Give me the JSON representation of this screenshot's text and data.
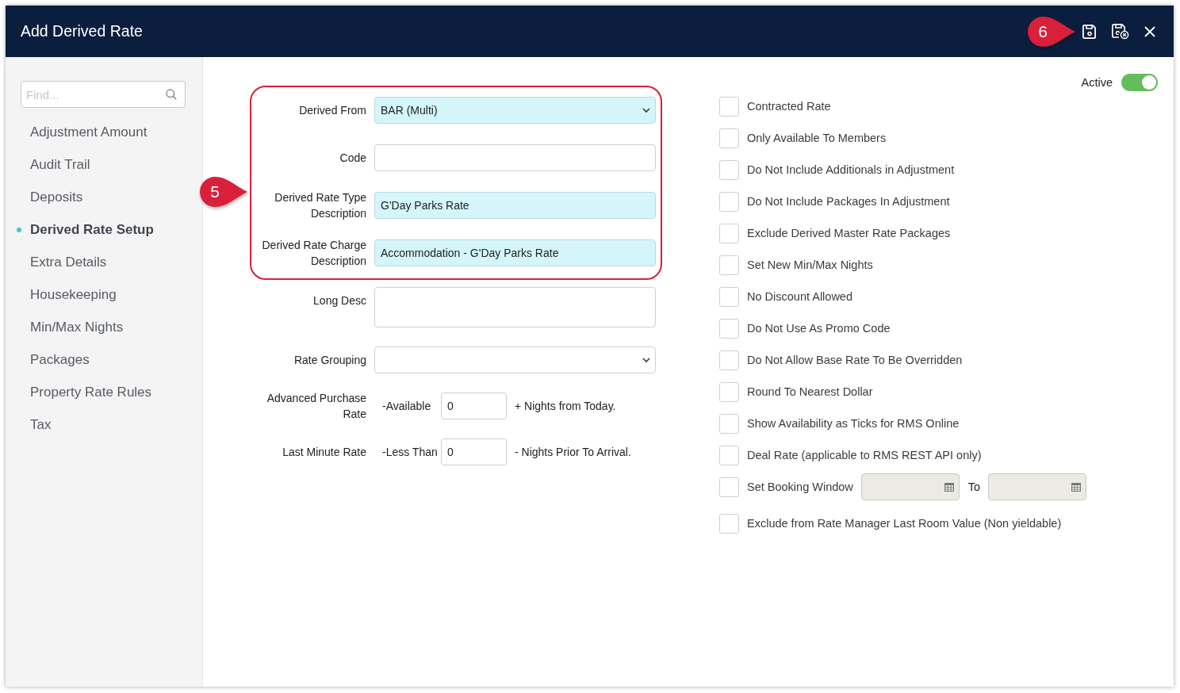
{
  "window": {
    "title": "Add Derived Rate"
  },
  "header_callout": {
    "label": "6"
  },
  "sidebar": {
    "search": {
      "placeholder": "Find..."
    },
    "items": [
      {
        "label": "Adjustment Amount",
        "selected": false
      },
      {
        "label": "Audit Trail",
        "selected": false
      },
      {
        "label": "Deposits",
        "selected": false
      },
      {
        "label": "Derived Rate Setup",
        "selected": true
      },
      {
        "label": "Extra Details",
        "selected": false
      },
      {
        "label": "Housekeeping",
        "selected": false
      },
      {
        "label": "Min/Max Nights",
        "selected": false
      },
      {
        "label": "Packages",
        "selected": false
      },
      {
        "label": "Property Rate Rules",
        "selected": false
      },
      {
        "label": "Tax",
        "selected": false
      }
    ]
  },
  "form": {
    "callout": {
      "label": "5"
    },
    "boxed_fields": [
      {
        "kind": "select",
        "label": "Derived From",
        "value": "BAR (Multi)",
        "highlighted": true
      },
      {
        "kind": "text",
        "label": "Code",
        "highlighted": false
      },
      {
        "kind": "text",
        "label": "Derived Rate Type Description",
        "value": "G'Day Parks Rate",
        "highlighted": true
      },
      {
        "kind": "text",
        "label": "Derived Rate Charge Description",
        "value": "Accommodation - G'Day Parks Rate",
        "highlighted": true
      }
    ],
    "fields": [
      {
        "kind": "textarea",
        "label": "Long Desc",
        "highlighted": false
      },
      {
        "kind": "select",
        "label": "Rate Grouping",
        "highlighted": false
      },
      {
        "kind": "nights",
        "label": "Advanced Purchase Rate",
        "prefix": "-Available",
        "value": "0",
        "suffix": "+ Nights from Today."
      },
      {
        "kind": "nights",
        "label": "Last Minute Rate",
        "prefix": "-Less Than",
        "value": "0",
        "suffix": "- Nights Prior To Arrival."
      }
    ]
  },
  "active": {
    "label": "Active",
    "on": true
  },
  "options": [
    {
      "kind": "checkbox",
      "label": "Contracted Rate",
      "checked": false
    },
    {
      "kind": "checkbox",
      "label": "Only Available To Members",
      "checked": false
    },
    {
      "kind": "checkbox",
      "label": "Do Not Include Additionals in Adjustment",
      "checked": false
    },
    {
      "kind": "checkbox",
      "label": "Do Not Include Packages In Adjustment",
      "checked": false
    },
    {
      "kind": "checkbox",
      "label": "Exclude Derived Master Rate Packages",
      "checked": false
    },
    {
      "kind": "checkbox",
      "label": "Set New Min/Max Nights",
      "checked": false
    },
    {
      "kind": "checkbox",
      "label": "No Discount Allowed",
      "checked": false
    },
    {
      "kind": "checkbox",
      "label": "Do Not Use As Promo Code",
      "checked": false
    },
    {
      "kind": "checkbox",
      "label": "Do Not Allow Base Rate To Be Overridden",
      "checked": false
    },
    {
      "kind": "checkbox",
      "label": "Round To Nearest Dollar",
      "checked": false
    },
    {
      "kind": "checkbox",
      "label": "Show Availability as Ticks for RMS Online",
      "checked": false
    },
    {
      "kind": "checkbox",
      "label": "Deal Rate (applicable to RMS REST API only)",
      "checked": false
    },
    {
      "kind": "date_range",
      "label": "Set Booking Window",
      "checked": false,
      "to_label": "To",
      "dates_disabled": true
    },
    {
      "kind": "checkbox",
      "label": "Exclude from Rate Manager Last Room Value (Non yieldable)",
      "checked": false
    }
  ]
}
